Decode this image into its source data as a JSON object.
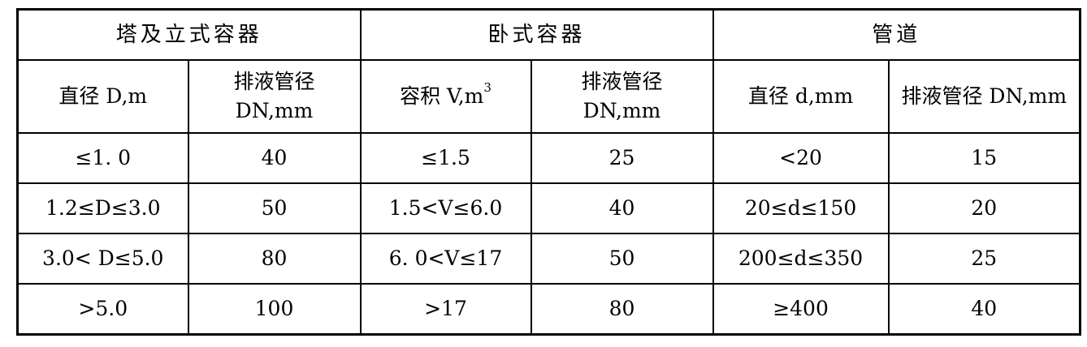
{
  "group_headers": {
    "tower": "塔及立式容器",
    "horizontal": "卧式容器",
    "pipe": "管道"
  },
  "sub_headers": {
    "tower_diameter": "直径 D,m",
    "tower_drain_line1": "排液管径",
    "tower_drain_line2": "DN,mm",
    "horiz_volume_text": "容积 V,m",
    "horiz_volume_sup": "3",
    "horiz_drain_line1": "排液管径",
    "horiz_drain_line2": "DN,mm",
    "pipe_diameter": "直径 d,mm",
    "pipe_drain": "排液管径 DN,mm"
  },
  "rows": [
    {
      "tower_d": "≤1. 0",
      "tower_dn": "40",
      "horiz_v": "≤1.5",
      "horiz_dn": "25",
      "pipe_d": "<20",
      "pipe_dn": "15"
    },
    {
      "tower_d": "1.2≤D≤3.0",
      "tower_dn": "50",
      "horiz_v": "1.5<V≤6.0",
      "horiz_dn": "40",
      "pipe_d": "20≤d≤150",
      "pipe_dn": "20"
    },
    {
      "tower_d": "3.0< D≤5.0",
      "tower_dn": "80",
      "horiz_v": "6. 0<V≤17",
      "horiz_dn": "50",
      "pipe_d": "200≤d≤350",
      "pipe_dn": "25"
    },
    {
      "tower_d": ">5.0",
      "tower_dn": "100",
      "horiz_v": ">17",
      "horiz_dn": "80",
      "pipe_d": "≥400",
      "pipe_dn": "40"
    }
  ]
}
